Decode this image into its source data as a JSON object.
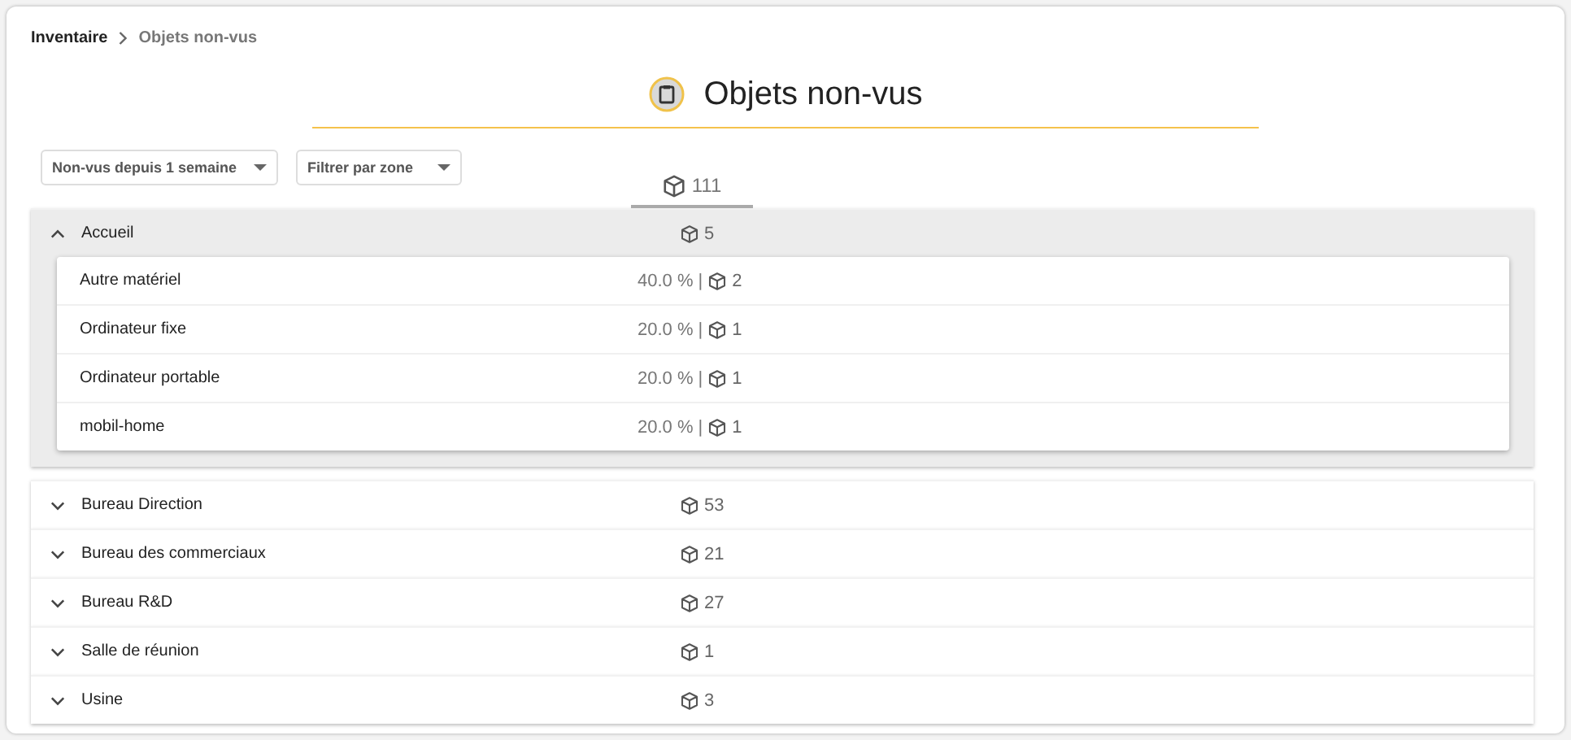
{
  "breadcrumb": [
    {
      "label": "Inventaire",
      "current": false
    },
    {
      "label": "Objets non-vus",
      "current": true
    }
  ],
  "title": "Objets non-vus",
  "filters": [
    {
      "label": "Non-vus depuis 1 semaine"
    },
    {
      "label": "Filtrer par zone"
    }
  ],
  "total": "111",
  "zones": [
    {
      "name": "Accueil",
      "count": "5",
      "expanded": true,
      "items": [
        {
          "name": "Autre matériel",
          "percent": "40.0 % |",
          "count": "2"
        },
        {
          "name": "Ordinateur fixe",
          "percent": "20.0 % |",
          "count": "1"
        },
        {
          "name": "Ordinateur portable",
          "percent": "20.0 % |",
          "count": "1"
        },
        {
          "name": "mobil-home",
          "percent": "20.0 % |",
          "count": "1"
        }
      ]
    },
    {
      "name": "Bureau Direction",
      "count": "53",
      "expanded": false
    },
    {
      "name": "Bureau des commerciaux",
      "count": "21",
      "expanded": false
    },
    {
      "name": "Bureau R&D",
      "count": "27",
      "expanded": false
    },
    {
      "name": "Salle de réunion",
      "count": "1",
      "expanded": false
    },
    {
      "name": "Usine",
      "count": "3",
      "expanded": false
    }
  ]
}
